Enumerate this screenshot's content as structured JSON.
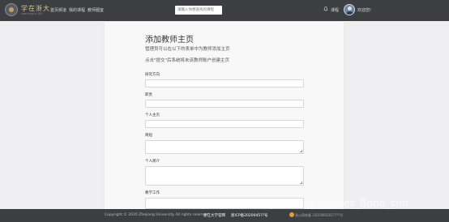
{
  "navbar": {
    "brand_name": "学在浙大",
    "brand_sub": "Learning in ZJU",
    "links": [
      "首页频道",
      "我的课程",
      "教师圈室"
    ],
    "search_placeholder": "请输入你想查找的课程",
    "messages_label": "课程",
    "user_greeting": "欢迎您!"
  },
  "form": {
    "title": "添加教师主页",
    "desc_1": "管理员可以在以下的表单中为教师添加主页",
    "desc_2": "点击\"提交\"后系统将未该教师账户创建主页",
    "fields": [
      {
        "label": "研究方向"
      },
      {
        "label": "职责"
      },
      {
        "label": "个人主页"
      },
      {
        "label": "简短"
      },
      {
        "label": "个人简介"
      },
      {
        "label": "教学工作"
      }
    ]
  },
  "footer": {
    "copyright": "Copyright © 2020 Zhejiang University All rights reserved.",
    "university": "浙江大学官网",
    "icp": "浙ICP备2020045??号",
    "police": "浙公网安备 3301060201????号"
  },
  "watermark": "https://blog.csdn.net/James_Bond_slm",
  "colors": {
    "navbar_bg": "#3d3e41",
    "page_bg": "#efeff1",
    "card_bg": "#f8f8f9"
  }
}
